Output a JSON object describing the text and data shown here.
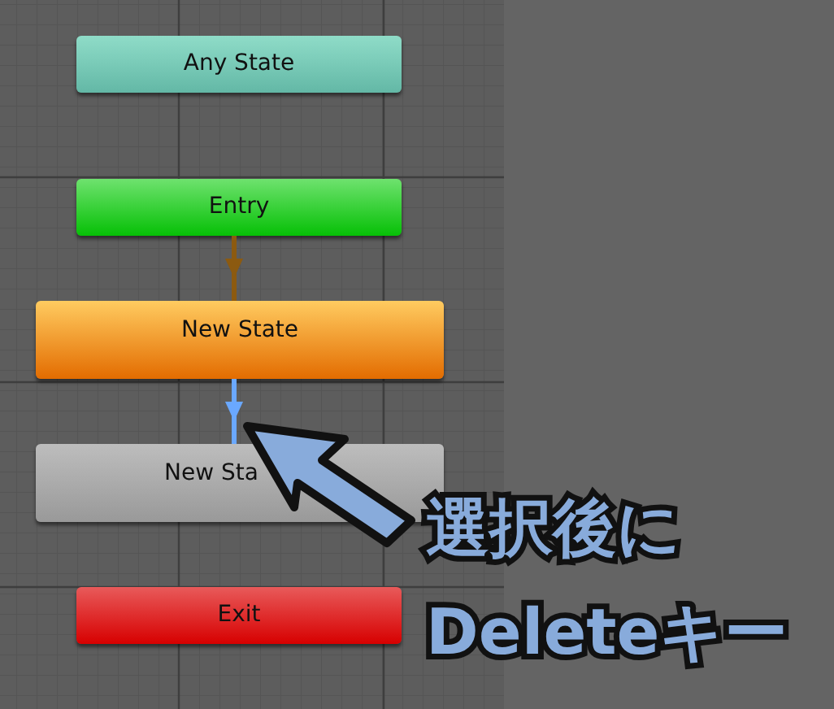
{
  "nodes": [
    {
      "kind": "any",
      "label": "Any State"
    },
    {
      "kind": "entry",
      "label": "Entry"
    },
    {
      "kind": "default",
      "label": "New State"
    },
    {
      "kind": "state",
      "label": "New Sta"
    },
    {
      "kind": "exit",
      "label": "Exit"
    }
  ],
  "transitions": [
    {
      "kind": "entry",
      "selected": false
    },
    {
      "kind": "state",
      "selected": true
    }
  ],
  "callout": {
    "lines": [
      "選択後に",
      "Deleteキー"
    ]
  }
}
